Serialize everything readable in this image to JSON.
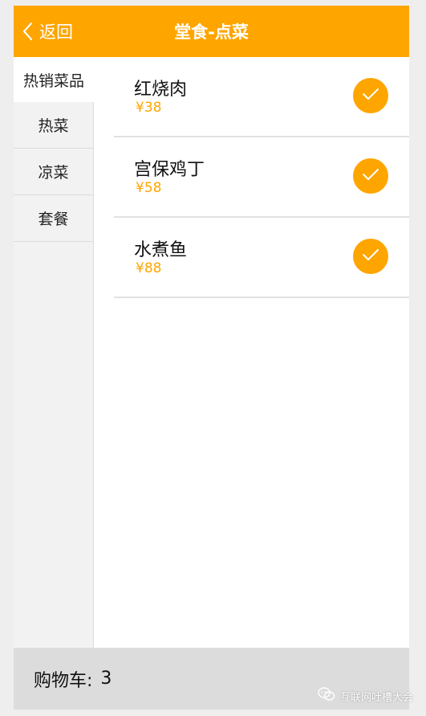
{
  "header": {
    "back_label": "返回",
    "title": "堂食-点菜",
    "accent_color": "#ffa500"
  },
  "sidebar": {
    "items": [
      {
        "label": "热销菜品",
        "active": true
      },
      {
        "label": "热菜",
        "active": false
      },
      {
        "label": "凉菜",
        "active": false
      },
      {
        "label": "套餐",
        "active": false
      }
    ]
  },
  "menu": {
    "items": [
      {
        "name": "红烧肉",
        "price": "¥38",
        "selected": true
      },
      {
        "name": "宫保鸡丁",
        "price": "¥58",
        "selected": true
      },
      {
        "name": "水煮鱼",
        "price": "¥88",
        "selected": true
      }
    ]
  },
  "footer": {
    "cart_label": "购物车:",
    "cart_count": "3"
  },
  "watermark": {
    "text": "互联网吐槽大会",
    "icon": "wechat-icon"
  }
}
